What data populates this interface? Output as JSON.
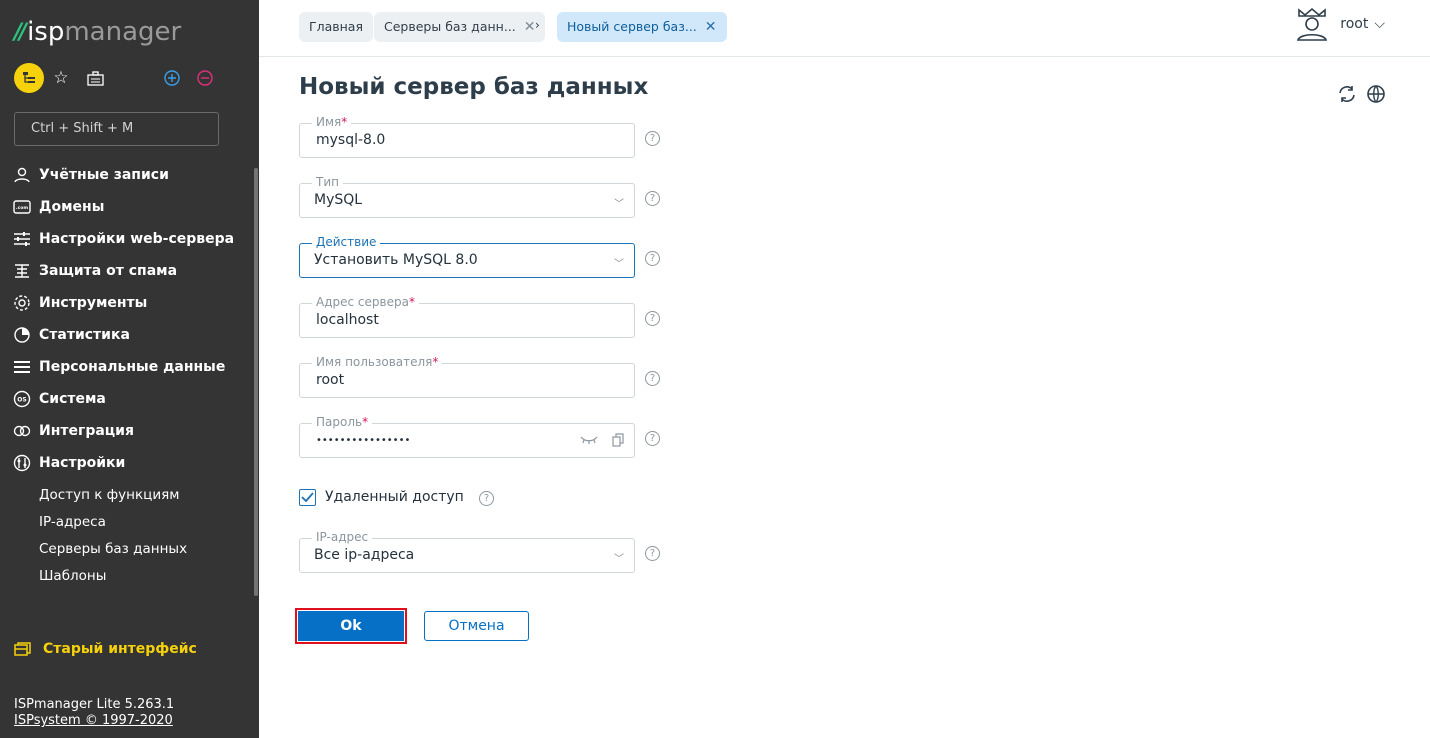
{
  "app": {
    "logo_isp": "isp",
    "logo_manager": "manager"
  },
  "sidebar": {
    "search_placeholder": "Ctrl + Shift + M",
    "items": [
      {
        "label": "Учётные записи",
        "icon": "users-icon"
      },
      {
        "label": "Домены",
        "icon": "domain-icon"
      },
      {
        "label": "Настройки web-сервера",
        "icon": "sliders-icon"
      },
      {
        "label": "Защита от спама",
        "icon": "spam-filter-icon"
      },
      {
        "label": "Инструменты",
        "icon": "gear-icon"
      },
      {
        "label": "Статистика",
        "icon": "pie-chart-icon"
      },
      {
        "label": "Персональные данные",
        "icon": "list-icon"
      },
      {
        "label": "Система",
        "icon": "os-icon"
      },
      {
        "label": "Интеграция",
        "icon": "integration-icon"
      },
      {
        "label": "Настройки",
        "icon": "settings-icon"
      }
    ],
    "subitems": [
      {
        "label": "Доступ к функциям"
      },
      {
        "label": "IP-адреса"
      },
      {
        "label": "Серверы баз данных"
      },
      {
        "label": "Шаблоны"
      }
    ],
    "old_interface": "Старый интерфейс",
    "version": "ISPmanager Lite 5.263.1",
    "copyright": "ISPsystem © 1997-2020"
  },
  "topbar": {
    "tabs": [
      {
        "label": "Главная"
      },
      {
        "label": "Серверы баз данн..."
      },
      {
        "label": "Новый сервер баз..."
      }
    ],
    "user": "root"
  },
  "form": {
    "title": "Новый сервер баз данных",
    "name": {
      "label": "Имя",
      "value": "mysql-8.0"
    },
    "type": {
      "label": "Тип",
      "value": "MySQL"
    },
    "action": {
      "label": "Действие",
      "value": "Установить MySQL 8.0"
    },
    "address": {
      "label": "Адрес сервера",
      "value": "localhost"
    },
    "username": {
      "label": "Имя пользователя",
      "value": "root"
    },
    "password": {
      "label": "Пароль",
      "value": "••••••••••••••••"
    },
    "remote": {
      "label": "Удаленный доступ",
      "checked": true
    },
    "ip": {
      "label": "IP-адрес",
      "value": "Все ip-адреса"
    },
    "ok": "Ok",
    "cancel": "Отмена"
  },
  "colors": {
    "accent": "#0570c6",
    "sidebar": "#343434",
    "highlight": "#f5d20b",
    "brand_green": "#2ec27e"
  }
}
